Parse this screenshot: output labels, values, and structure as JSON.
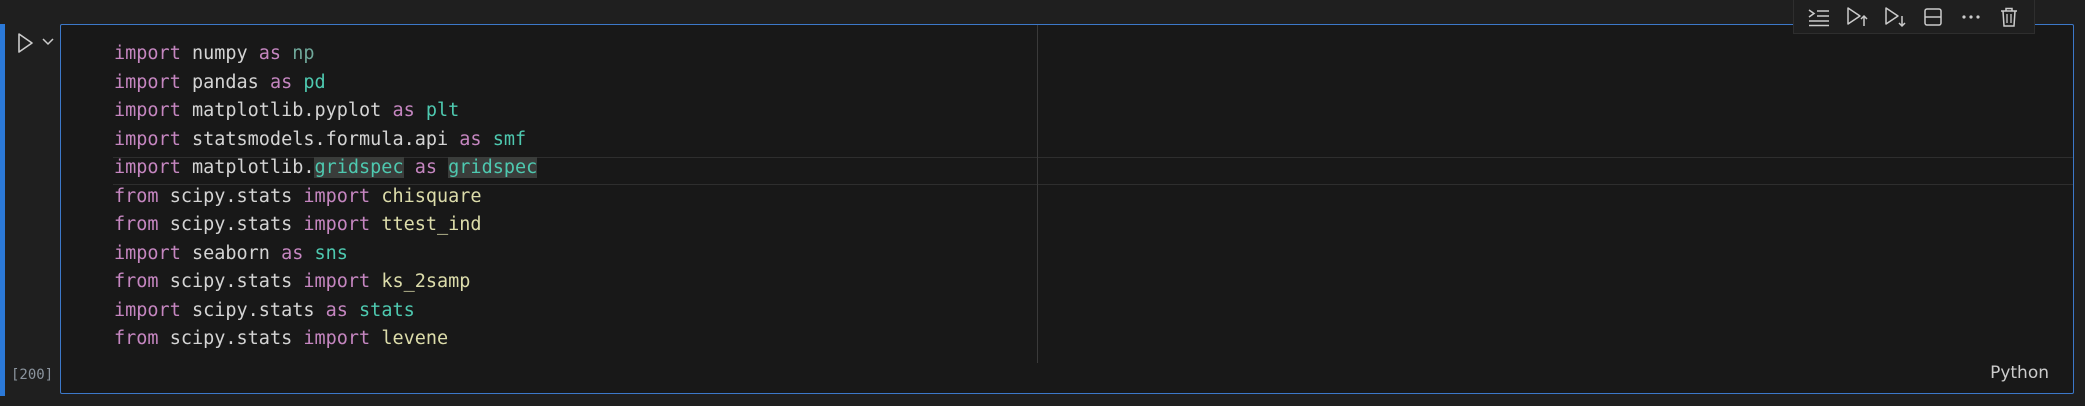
{
  "cell": {
    "execution_count": "[200]",
    "language": "Python",
    "code_lines": [
      [
        {
          "t": "import",
          "c": "kw"
        },
        {
          "t": " numpy ",
          "c": "mod"
        },
        {
          "t": "as",
          "c": "kw"
        },
        {
          "t": " ",
          "c": "mod"
        },
        {
          "t": "np",
          "c": "alias-dim"
        }
      ],
      [
        {
          "t": "import",
          "c": "kw"
        },
        {
          "t": " pandas ",
          "c": "mod"
        },
        {
          "t": "as",
          "c": "kw"
        },
        {
          "t": " ",
          "c": "mod"
        },
        {
          "t": "pd",
          "c": "alias"
        }
      ],
      [
        {
          "t": "import",
          "c": "kw"
        },
        {
          "t": " matplotlib.pyplot ",
          "c": "mod"
        },
        {
          "t": "as",
          "c": "kw"
        },
        {
          "t": " ",
          "c": "mod"
        },
        {
          "t": "plt",
          "c": "alias"
        }
      ],
      [
        {
          "t": "import",
          "c": "kw"
        },
        {
          "t": " statsmodels.formula.api ",
          "c": "mod"
        },
        {
          "t": "as",
          "c": "kw"
        },
        {
          "t": " ",
          "c": "mod"
        },
        {
          "t": "smf",
          "c": "alias"
        }
      ],
      [
        {
          "t": "import",
          "c": "kw"
        },
        {
          "t": " matplotlib.",
          "c": "mod"
        },
        {
          "t": "gridspec",
          "c": "alias hl"
        },
        {
          "t": " ",
          "c": "mod"
        },
        {
          "t": "as",
          "c": "kw"
        },
        {
          "t": " ",
          "c": "mod"
        },
        {
          "t": "gridspec",
          "c": "alias hl"
        }
      ],
      [
        {
          "t": "from",
          "c": "kw"
        },
        {
          "t": " scipy.stats ",
          "c": "mod"
        },
        {
          "t": "import",
          "c": "kw"
        },
        {
          "t": " ",
          "c": "mod"
        },
        {
          "t": "chisquare",
          "c": "fn"
        }
      ],
      [
        {
          "t": "from",
          "c": "kw"
        },
        {
          "t": " scipy.stats ",
          "c": "mod"
        },
        {
          "t": "import",
          "c": "kw"
        },
        {
          "t": " ",
          "c": "mod"
        },
        {
          "t": "ttest_ind",
          "c": "fn"
        }
      ],
      [
        {
          "t": "import",
          "c": "kw"
        },
        {
          "t": " seaborn ",
          "c": "mod"
        },
        {
          "t": "as",
          "c": "kw"
        },
        {
          "t": " ",
          "c": "mod"
        },
        {
          "t": "sns",
          "c": "alias"
        }
      ],
      [
        {
          "t": "from",
          "c": "kw"
        },
        {
          "t": " scipy.stats ",
          "c": "mod"
        },
        {
          "t": "import",
          "c": "kw"
        },
        {
          "t": " ",
          "c": "mod"
        },
        {
          "t": "ks_2samp",
          "c": "fn"
        }
      ],
      [
        {
          "t": "import",
          "c": "kw"
        },
        {
          "t": " scipy.stats ",
          "c": "mod"
        },
        {
          "t": "as",
          "c": "kw"
        },
        {
          "t": " ",
          "c": "mod"
        },
        {
          "t": "stats",
          "c": "alias"
        }
      ],
      [
        {
          "t": "from",
          "c": "kw"
        },
        {
          "t": " scipy.stats ",
          "c": "mod"
        },
        {
          "t": "import",
          "c": "kw"
        },
        {
          "t": " ",
          "c": "mod"
        },
        {
          "t": "levene",
          "c": "fn"
        }
      ]
    ]
  },
  "toolbar": {
    "icons": [
      "execute-above-cells-icon",
      "run-above-icon",
      "run-below-icon",
      "split-cell-icon",
      "more-actions-icon",
      "delete-cell-icon"
    ]
  },
  "colors": {
    "background": "#1f1f1f",
    "editor_background": "#181818",
    "focus_border": "#3c78c9",
    "focus_bar": "#2b79d8",
    "keyword": "#c586c0",
    "function": "#dcdcaa",
    "alias": "#4ec9b0"
  }
}
